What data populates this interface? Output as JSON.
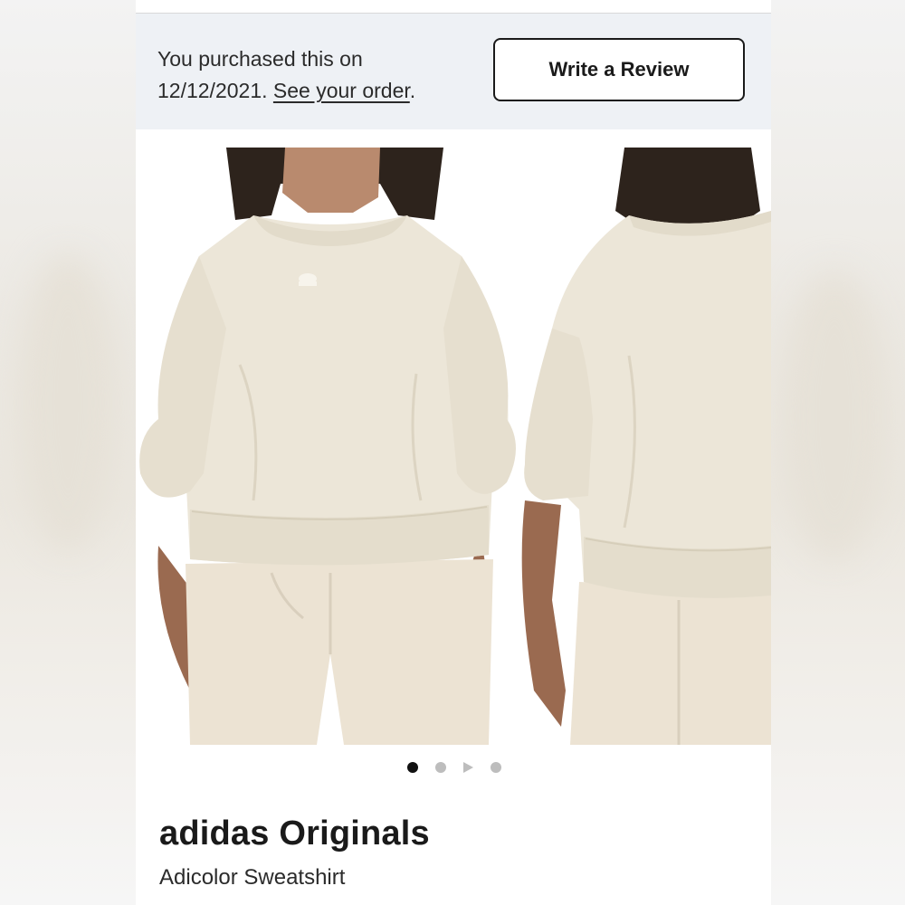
{
  "purchase_banner": {
    "text": "You purchased this on 12/12/2021.",
    "text_line1": "You purchased this on",
    "date_text": "12/12/2021.",
    "order_link": "See your order",
    "trailing": ".",
    "review_button": "Write a Review"
  },
  "product": {
    "image_alt": "Adicolor Sweatshirt front and back views",
    "brand": "adidas Originals",
    "name": "Adicolor Sweatshirt",
    "color_hex": "#ece6d8"
  },
  "carousel": {
    "total_items": 4,
    "active_index": 0,
    "items": [
      "image",
      "image",
      "video",
      "image"
    ]
  },
  "icons": {
    "play": "play-icon"
  }
}
